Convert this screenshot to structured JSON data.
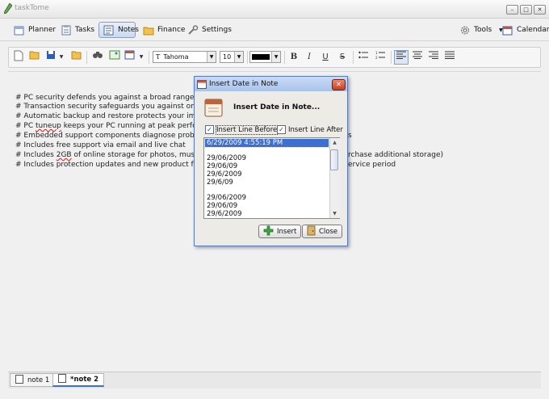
{
  "window": {
    "title": "taskTome"
  },
  "nav": {
    "planner": "Planner",
    "tasks": "Tasks",
    "notes": "Notes",
    "finance": "Finance",
    "settings": "Settings",
    "tools": "Tools",
    "calendar": "Calendar"
  },
  "format": {
    "font": "Tahoma",
    "size": "10",
    "color": "#000000",
    "bold": "B",
    "italic": "I",
    "underline": "U",
    "strike": "S"
  },
  "editor": {
    "lines": [
      [
        "# PC security defends you against a broad range of"
      ],
      [
        "# Transaction security safeguards you against online"
      ],
      [
        "# Automatic backup and restore protects your impor"
      ],
      [
        "# PC ",
        "tuneup",
        " keeps your PC running at peak perform"
      ],
      [
        "# Embedded support components diagnose problem",
        "s"
      ],
      [
        "# Includes free support via email and live chat"
      ],
      [
        "# Includes ",
        "2GB",
        " of online storage for photos, music, ",
        "rchase additional storage)"
      ],
      [
        "# Includes protection updates and new product featu",
        "ervice period"
      ]
    ]
  },
  "tabs": [
    {
      "label": "note 1"
    },
    {
      "label": "*note 2"
    }
  ],
  "dialog": {
    "title": "Insert Date in Note",
    "heading": "Insert Date in Note...",
    "insert_before": "Insert Line Before",
    "insert_after": "Insert Line After",
    "items": [
      "6/29/2009 4:55:19 PM",
      "",
      "29/06/2009",
      "29/06/09",
      "29/6/2009",
      "29/6/09",
      "",
      "29/06/2009",
      "29/06/09",
      "29/6/2009"
    ],
    "insert_button": "Insert",
    "close_button": "Close"
  },
  "colors": {
    "accent": "#3d6fd1",
    "dialog_border": "#5b7cbf"
  }
}
